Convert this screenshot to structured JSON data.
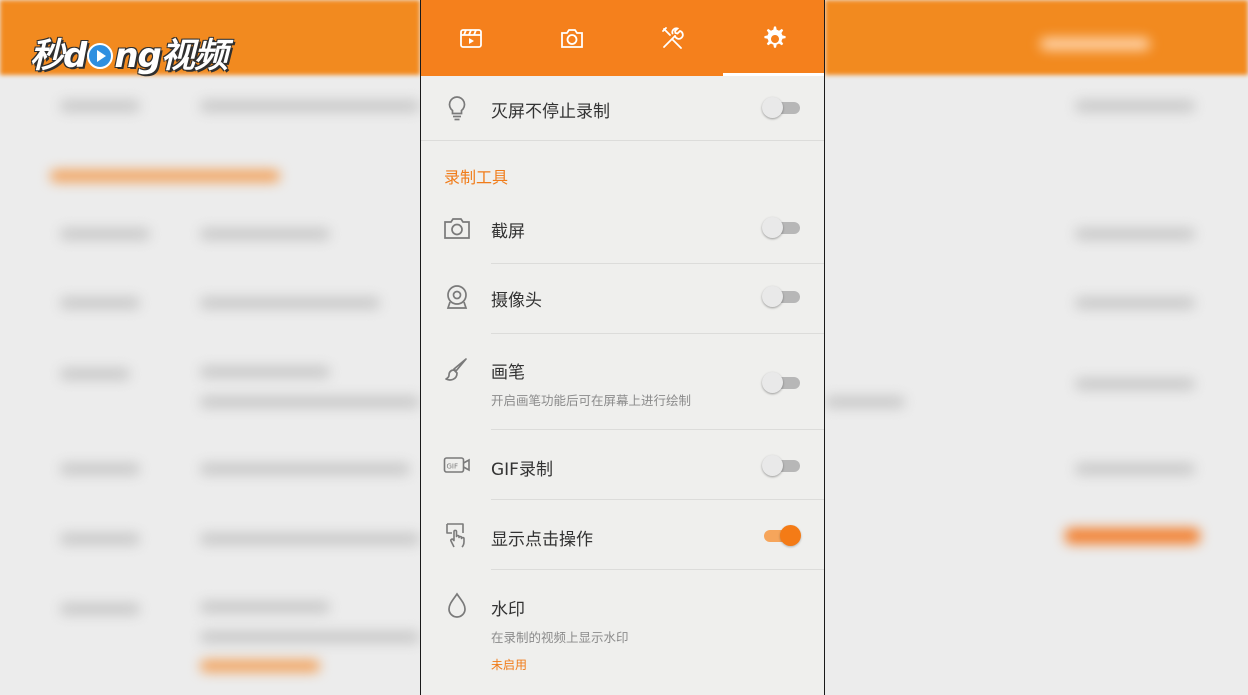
{
  "watermark": {
    "brand_text": "秒dong视频"
  },
  "tabs": [
    {
      "name": "video",
      "icon": "video-icon",
      "active": false
    },
    {
      "name": "camera",
      "icon": "camera-icon",
      "active": false
    },
    {
      "name": "tools",
      "icon": "tools-icon",
      "active": false
    },
    {
      "name": "settings",
      "icon": "gear-icon",
      "active": true
    }
  ],
  "settings": {
    "screen_off": {
      "label": "灭屏不停止录制",
      "icon": "bulb-icon",
      "enabled": false
    },
    "section_tools": "录制工具",
    "screenshot": {
      "label": "截屏",
      "icon": "camera-icon",
      "enabled": false
    },
    "webcam": {
      "label": "摄像头",
      "icon": "webcam-icon",
      "enabled": false
    },
    "brush": {
      "label": "画笔",
      "description": "开启画笔功能后可在屏幕上进行绘制",
      "icon": "brush-icon",
      "enabled": false
    },
    "gif": {
      "label": "GIF录制",
      "icon": "gif-camera-icon",
      "enabled": false
    },
    "show_touches": {
      "label": "显示点击操作",
      "icon": "touch-icon",
      "enabled": true
    },
    "watermark": {
      "label": "水印",
      "description": "在录制的视频上显示水印",
      "status": "未启用",
      "icon": "droplet-icon"
    }
  },
  "colors": {
    "accent": "#f5801c",
    "toggle_on": "#f47b16",
    "toggle_off_track": "#b7b7b7",
    "section_header": "#f07c1a"
  }
}
